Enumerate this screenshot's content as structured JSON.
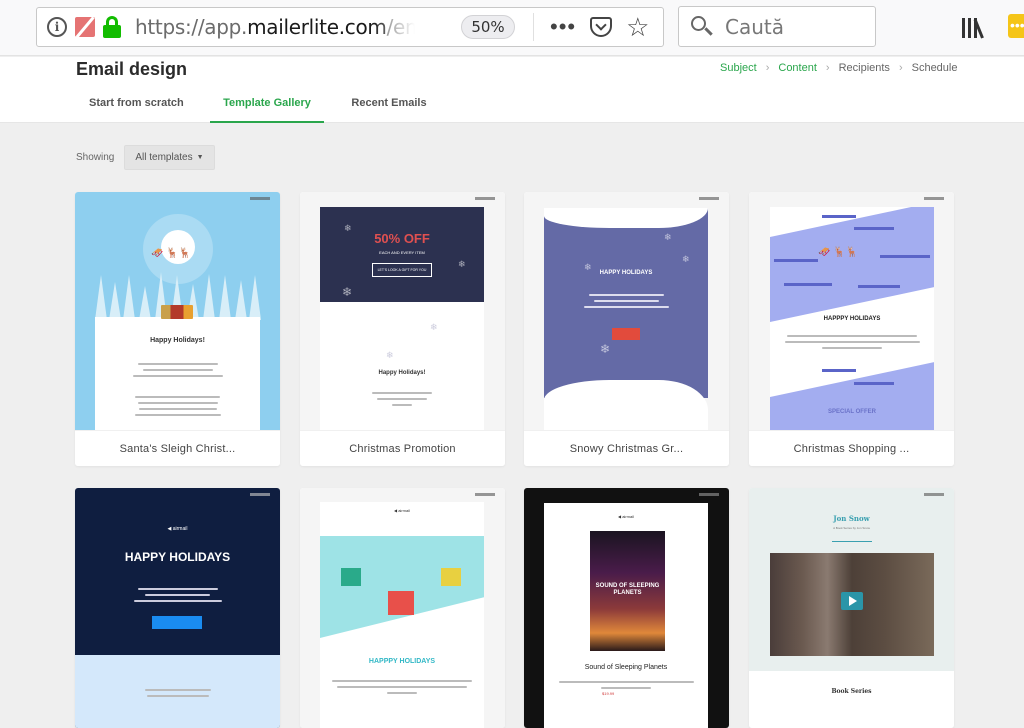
{
  "browser": {
    "url_prefix": "https://app.",
    "url_host": "mailerlite.com",
    "url_suffix": "/emai",
    "zoom": "50%",
    "more_label": "•••",
    "star_label": "☆",
    "search_placeholder": "Caută",
    "ext_label": "•••",
    "info_label": "i"
  },
  "page": {
    "title": "Email design",
    "breadcrumb": [
      {
        "label": "Subject",
        "done": true
      },
      {
        "label": "Content",
        "done": true
      },
      {
        "label": "Recipients",
        "done": false
      },
      {
        "label": "Schedule",
        "done": false
      }
    ],
    "breadcrumb_sep": "›",
    "tabs": [
      {
        "label": "Start from scratch",
        "active": false
      },
      {
        "label": "Template Gallery",
        "active": true
      },
      {
        "label": "Recent Emails",
        "active": false
      }
    ]
  },
  "filter": {
    "label": "Showing",
    "selected": "All templates",
    "caret": "▼"
  },
  "templates": [
    {
      "name": "Santa's Sleigh Christ...",
      "headline": "Happy Holidays!",
      "sleigh": "🛷 🦌🦌"
    },
    {
      "name": "Christmas Promotion",
      "headline": "50% OFF",
      "subline": "EACH AND EVERY ITEM",
      "button": "LET'S LOOK A GIFT FOR YOU",
      "body_headline": "Happy Holidays!"
    },
    {
      "name": "Snowy Christmas Gr...",
      "headline": "HAPPY HOLIDAYS"
    },
    {
      "name": "Christmas Shopping ...",
      "headline": "HAPPPY HOLIDAYS",
      "offer": "SPECIAL OFFER",
      "sleigh": "🛷 🦌🦌"
    },
    {
      "name": "",
      "logo": "◀ airmail",
      "headline": "HAPPY HOLIDAYS"
    },
    {
      "name": "",
      "logo": "◀ airmail",
      "headline": "HAPPPY HOLIDAYS"
    },
    {
      "name": "",
      "logo": "◀ airmail",
      "cover_title": "SOUND OF SLEEPING PLANETS",
      "headline": "Sound of Sleeping Planets",
      "price": "$19.99"
    },
    {
      "name": "",
      "author": "Jon Snow",
      "subtitle": "A Book Series by Jon Snow",
      "section": "Book Series"
    }
  ]
}
